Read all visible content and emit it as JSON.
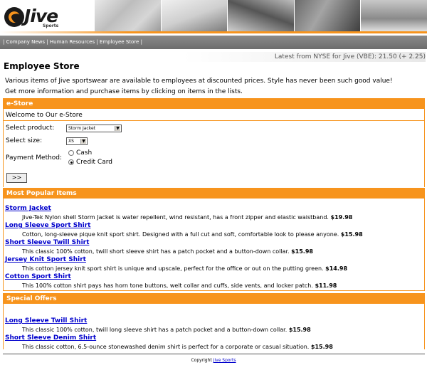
{
  "brand": {
    "name": "Jive",
    "sub": "Sports"
  },
  "nav": {
    "items": [
      "Company News",
      "Human Resources",
      "Employee Store"
    ]
  },
  "ticker": "Latest from NYSE for Jive (VBE): 21.50 (+ 2.25)",
  "page_title": "Employee Store",
  "intro": {
    "line1": "Various items of Jive sportswear are available to employees at discounted prices. Style has never been such good value!",
    "line2": "Get more information and purchase items by clicking on items in the lists."
  },
  "estore": {
    "header": "e-Store",
    "welcome": "Welcome to Our e-Store",
    "product_label": "Select product:",
    "product_value": "Storm Jacket",
    "size_label": "Select size:",
    "size_value": "XS",
    "payment_label": "Payment Method:",
    "payment_options": [
      "Cash",
      "Credit Card"
    ],
    "payment_selected": "Credit Card",
    "submit_label": ">>"
  },
  "popular": {
    "header": "Most Popular Items",
    "items": [
      {
        "name": "Storm Jacket",
        "desc": "Jive-Tek Nylon shell Storm Jacket is water repellent, wind resistant, has a front zipper and elastic waistband.",
        "price": "$19.98"
      },
      {
        "name": "Long Sleeve Sport Shirt",
        "desc": "Cotton, long-sleeve pique knit sport shirt. Designed with a full cut and soft, comfortable look to please anyone.",
        "price": "$15.98"
      },
      {
        "name": "Short Sleeve Twill Shirt",
        "desc": "This classic 100% cotton, twill short sleeve shirt has a patch pocket and a button-down collar.",
        "price": "$15.98"
      },
      {
        "name": "Jersey Knit Sport Shirt",
        "desc": "This cotton jersey knit sport shirt is unique and upscale, perfect for the office or out on the putting green.",
        "price": "$14.98"
      },
      {
        "name": "Cotton Sport Shirt",
        "desc": "This 100% cotton shirt pays has horn tone buttons, welt collar and cuffs, side vents, and locker patch.",
        "price": "$11.98"
      }
    ]
  },
  "special": {
    "header": "Special Offers",
    "items": [
      {
        "name": "Long Sleeve Twill Shirt",
        "desc": "This classic 100% cotton, twill long sleeve shirt has a patch pocket and a button-down collar.",
        "price": "$15.98"
      },
      {
        "name": "Short Sleeve Denim Shirt",
        "desc": "This classic cotton, 6.5-ounce stonewashed denim shirt is perfect for a corporate or casual situation.",
        "price": "$15.98"
      }
    ]
  },
  "footer": {
    "prefix": "Copyright",
    "link": "Jive Sports"
  },
  "colors": {
    "accent": "#f7941d",
    "link": "#0000cc",
    "nav_bg": "#7a7a7a"
  }
}
